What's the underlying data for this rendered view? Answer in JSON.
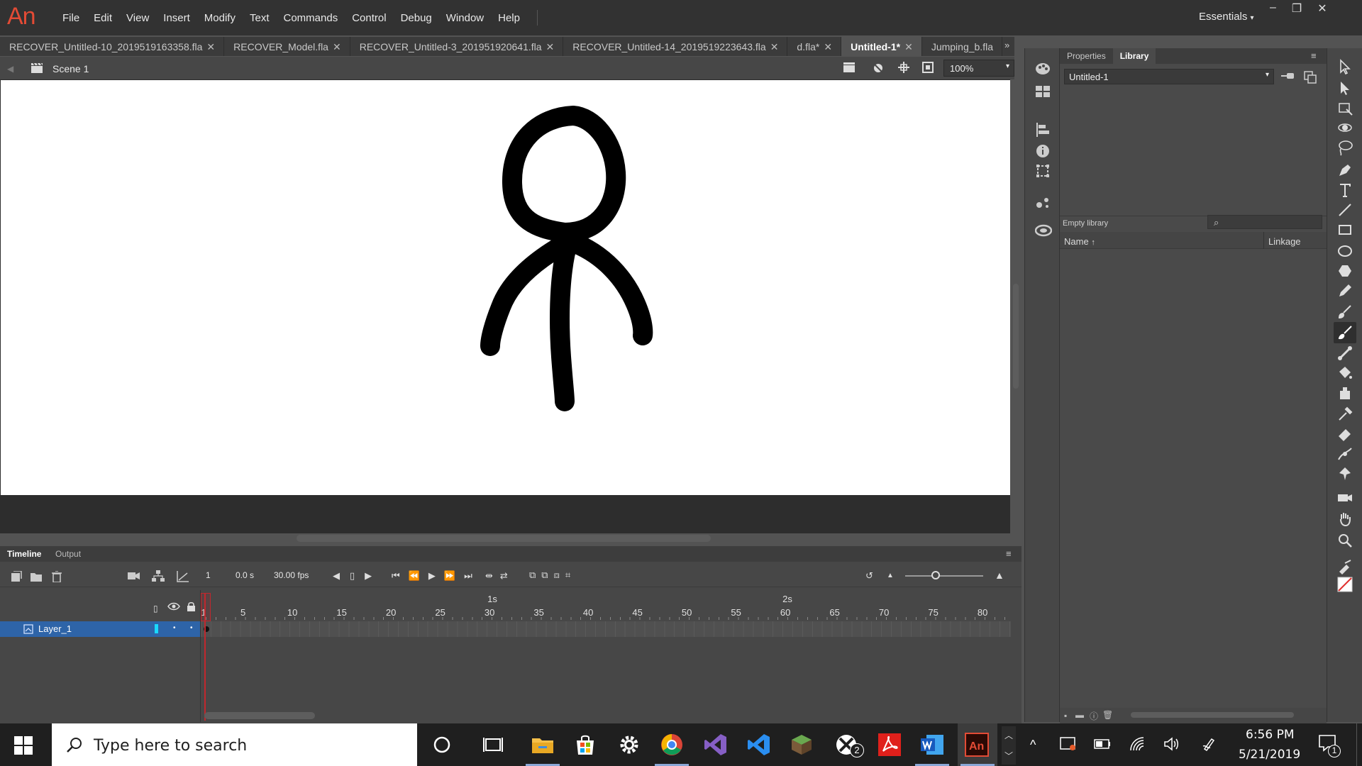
{
  "app": {
    "logo": "An",
    "menu": [
      "File",
      "Edit",
      "View",
      "Insert",
      "Modify",
      "Text",
      "Commands",
      "Control",
      "Debug",
      "Window",
      "Help"
    ],
    "workspace": "Essentials"
  },
  "doc_tabs": [
    {
      "label": "RECOVER_Untitled-10_2019519163358.fla",
      "active": false
    },
    {
      "label": "RECOVER_Model.fla",
      "active": false
    },
    {
      "label": "RECOVER_Untitled-3_201951920641.fla",
      "active": false
    },
    {
      "label": "RECOVER_Untitled-14_2019519223643.fla",
      "active": false
    },
    {
      "label": "d.fla*",
      "active": false
    },
    {
      "label": "Untitled-1*",
      "active": true
    },
    {
      "label": "Jumping_b.fla",
      "active": false
    }
  ],
  "editbar": {
    "scene": "Scene 1",
    "zoom": "100%"
  },
  "right_panel": {
    "tabs": [
      "Properties",
      "Library"
    ],
    "active_tab": "Library",
    "library_doc": "Untitled-1",
    "empty_label": "Empty library",
    "col_name": "Name",
    "col_linkage": "Linkage"
  },
  "timeline": {
    "tabs": [
      "Timeline",
      "Output"
    ],
    "current_frame": "1",
    "time": "0.0 s",
    "fps": "30.00 fps",
    "ruler_numbers": [
      "1",
      "5",
      "10",
      "15",
      "20",
      "25",
      "30",
      "35",
      "40",
      "45",
      "50",
      "55",
      "60",
      "65",
      "70",
      "75",
      "80"
    ],
    "second_labels": [
      "1s",
      "2s"
    ],
    "layer_name": "Layer_1"
  },
  "taskbar": {
    "search_placeholder": "Type here to search",
    "time": "6:56 PM",
    "date": "5/21/2019",
    "xbox_badge": "2",
    "notification_badge": "1"
  },
  "colors": {
    "accent_an": "#e34b35",
    "layer_selected": "#2e64a8",
    "playhead": "#c1272d",
    "stage": "#ffffff"
  }
}
